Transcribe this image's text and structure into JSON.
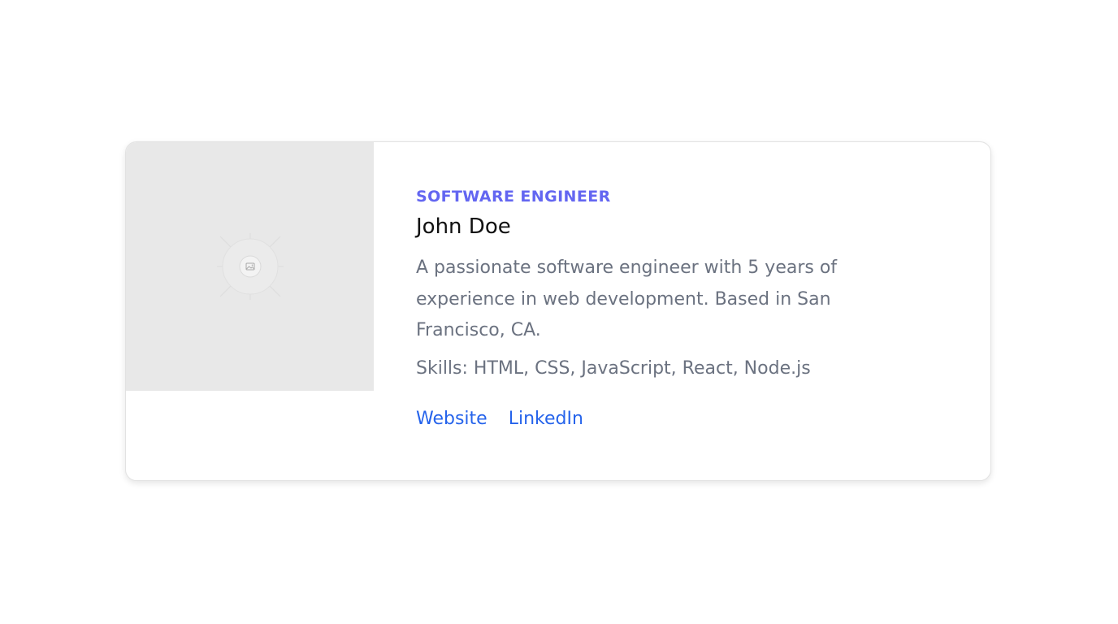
{
  "profile": {
    "role": "SOFTWARE ENGINEER",
    "name": "John Doe",
    "bio": "A passionate software engineer with 5 years of experience in web development. Based in San Francisco, CA.",
    "skills": "Skills: HTML, CSS, JavaScript, React, Node.js",
    "image_icon": "image-placeholder-icon"
  },
  "links": {
    "website": "Website",
    "linkedin": "LinkedIn"
  },
  "colors": {
    "role": "#6366f1",
    "link": "#2563eb",
    "muted_text": "#6b7280",
    "image_bg": "#e8e8e8"
  }
}
